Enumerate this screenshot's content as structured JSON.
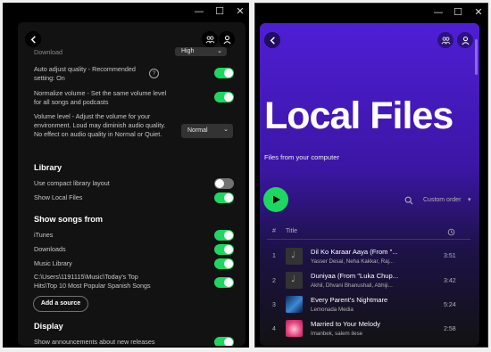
{
  "window_controls": {
    "minimize": "—",
    "maximize": "☐",
    "close": "✕"
  },
  "settings": {
    "download_label": "Download",
    "download_value": "High",
    "auto_adjust_label": "Auto adjust quality - Recommended setting: On",
    "auto_adjust_on": true,
    "normalize_label": "Normalize volume - Set the same volume level for all songs and podcasts",
    "normalize_on": true,
    "volume_level_label": "Volume level - Adjust the volume for your environment. Loud may diminish audio quality. No effect on audio quality in Normal or Quiet.",
    "volume_level_value": "Normal",
    "library_heading": "Library",
    "compact_label": "Use compact library layout",
    "compact_on": false,
    "show_local_label": "Show Local Files",
    "show_local_on": true,
    "show_songs_heading": "Show songs from",
    "sources": [
      {
        "label": "iTunes",
        "on": true
      },
      {
        "label": "Downloads",
        "on": true
      },
      {
        "label": "Music Library",
        "on": true
      },
      {
        "label": "C:\\Users\\1191115\\Music\\Today's Top Hits\\Top 10 Most Popular Spanish Songs",
        "on": true
      }
    ],
    "add_source_label": "Add a source",
    "display_heading": "Display",
    "announcements_label": "Show announcements about new releases",
    "announcements_on": true
  },
  "local_files": {
    "title": "Local Files",
    "subtitle": "Files from your computer",
    "sort_label": "Custom order",
    "col_num": "#",
    "col_title": "Title",
    "tracks": [
      {
        "num": "1",
        "title": "Dil Ko Karaar Aaya (From \"...",
        "artist": "Yasser Desai, Neha Kakkar, Raj...",
        "duration": "3:51",
        "thumb": "note"
      },
      {
        "num": "2",
        "title": "Duniyaa (From \"Luka Chup...",
        "artist": "Akhil, Dhvani Bhanushali, Abhiji...",
        "duration": "3:42",
        "thumb": "note"
      },
      {
        "num": "3",
        "title": "Every Parent's Nightmare",
        "artist": "Lemonada Media",
        "duration": "5:24",
        "thumb": "image-blue"
      },
      {
        "num": "4",
        "title": "Married to Your Melody",
        "artist": "Imanbek, salem ilese",
        "duration": "2:58",
        "thumb": "image-pink"
      }
    ]
  },
  "colors": {
    "accent_green": "#1ed760",
    "header_purple": "#4f1ed6",
    "panel_bg": "#121212"
  }
}
